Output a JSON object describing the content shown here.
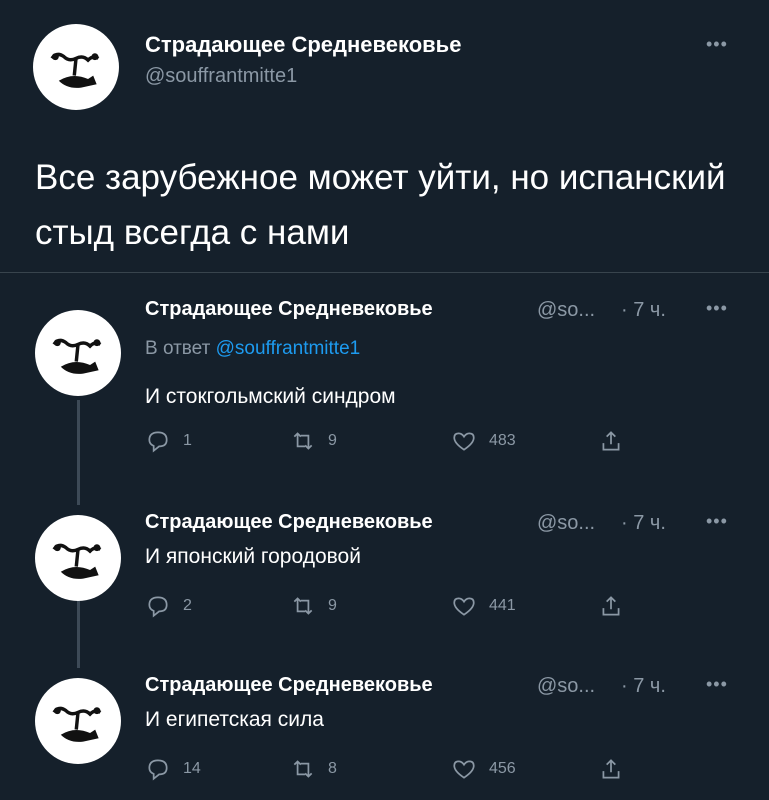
{
  "main_tweet": {
    "author_name": "Страдающее Средневековье",
    "handle": "@souffrantmitte1",
    "text": "Все зарубежное может уйти, но испанский стыд всегда с нами",
    "more_label": "•••"
  },
  "replies": [
    {
      "author_name": "Страдающее Средневековье",
      "handle_short": "@so...",
      "time": "· 7 ч.",
      "reply_prefix": "В ответ",
      "reply_mention": "@souffrantmitte1",
      "text": "И стокгольмский синдром",
      "replies_count": "1",
      "retweets_count": "9",
      "likes_count": "483",
      "more_label": "•••"
    },
    {
      "author_name": "Страдающее Средневековье",
      "handle_short": "@so...",
      "time": "· 7 ч.",
      "text": "И японский городовой",
      "replies_count": "2",
      "retweets_count": "9",
      "likes_count": "441",
      "more_label": "•••"
    },
    {
      "author_name": "Страдающее Средневековье",
      "handle_short": "@so...",
      "time": "· 7 ч.",
      "text": "И египетская сила",
      "replies_count": "14",
      "retweets_count": "8",
      "likes_count": "456",
      "more_label": "•••"
    }
  ],
  "colors": {
    "background": "#15202b",
    "text_primary": "#ffffff",
    "text_secondary": "#8b98a5",
    "link": "#1d9bf0",
    "divider": "#38444d"
  },
  "icons": [
    "avatar-logo-icon",
    "more-icon",
    "reply-icon",
    "retweet-icon",
    "like-icon",
    "share-icon"
  ]
}
